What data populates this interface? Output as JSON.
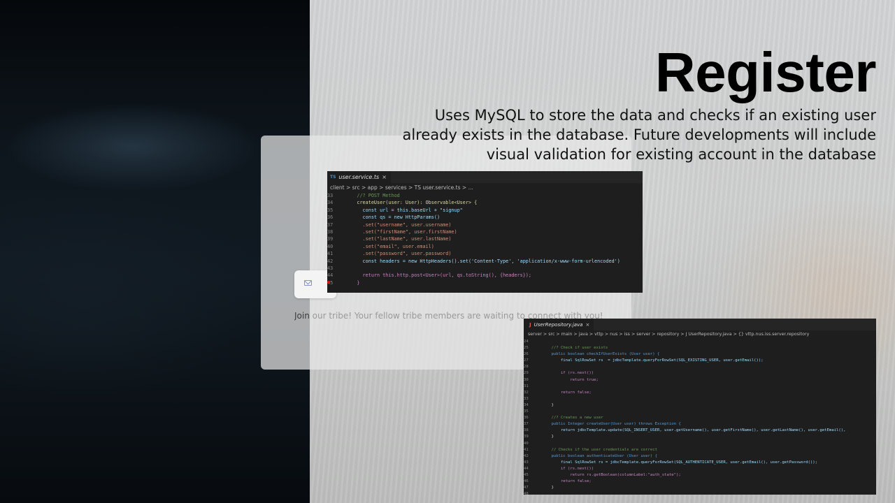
{
  "title": "Register",
  "description": "Uses MySQL to store the data and checks if an existing user already exists in the database. Future developments will include visual validation for existing account in the database",
  "login": {
    "tagline_visible": "Join",
    "tagline_faded": " our tribe! Your fellow tribe members are waiting to connect with you!"
  },
  "editor_ts": {
    "tab_badge": "TS",
    "tab_label": "user.service.ts",
    "close": "×",
    "breadcrumb": "client > src > app > services > TS user.service.ts > ...",
    "lines": [
      {
        "n": "33",
        "code": "    //? POST Method"
      },
      {
        "n": "34",
        "code": "    createUser(user: User): Observable<User> {"
      },
      {
        "n": "35",
        "code": "      const url = this.baseUrl + \"signup\""
      },
      {
        "n": "36",
        "code": "      const qs = new HttpParams()"
      },
      {
        "n": "37",
        "code": "      .set(\"username\", user.username)"
      },
      {
        "n": "38",
        "code": "      .set(\"firstName\", user.firstName)"
      },
      {
        "n": "39",
        "code": "      .set(\"lastName\", user.lastName)"
      },
      {
        "n": "40",
        "code": "      .set(\"email\", user.email)"
      },
      {
        "n": "41",
        "code": "      .set(\"password\", user.password)"
      },
      {
        "n": "42",
        "code": "      const headers = new HttpHeaders().set('Content-Type', 'application/x-www-form-urlencoded')"
      },
      {
        "n": "43",
        "code": ""
      },
      {
        "n": "44",
        "code": "      return this.http.post<User>(url, qs.toString(), {headers});"
      },
      {
        "n": "45",
        "code": "    }"
      }
    ]
  },
  "editor_java": {
    "tab_badge": "J",
    "tab_label": "UserRepository.java",
    "close": "×",
    "breadcrumb": "server > src > main > java > vttp > nus > iss > server > repository > J UserRepository.java > {} vttp.nus.iss.server.repository",
    "lines": [
      {
        "n": "24",
        "code": ""
      },
      {
        "n": "25",
        "code": "    //? Check if user exists"
      },
      {
        "n": "26",
        "code": "    public boolean checkIfUserExists (User user) {"
      },
      {
        "n": "27",
        "code": "        final SqlRowSet rs  = jdbcTemplate.queryForRowSet(SQL_EXISTING_USER, user.getEmail());"
      },
      {
        "n": "28",
        "code": ""
      },
      {
        "n": "29",
        "code": "        if (rs.next())"
      },
      {
        "n": "30",
        "code": "            return true;"
      },
      {
        "n": "31",
        "code": ""
      },
      {
        "n": "32",
        "code": "        return false;"
      },
      {
        "n": "33",
        "code": ""
      },
      {
        "n": "34",
        "code": "    }"
      },
      {
        "n": "35",
        "code": ""
      },
      {
        "n": "36",
        "code": "    //? Creates a new user"
      },
      {
        "n": "37",
        "code": "    public Integer createUser(User user) throws Exception {"
      },
      {
        "n": "38",
        "code": "        return jdbcTemplate.update(SQL_INSERT_USER, user.getUsername(), user.getFirstName(), user.getLastName(), user.getEmail(),"
      },
      {
        "n": "39",
        "code": "    }"
      },
      {
        "n": "40",
        "code": ""
      },
      {
        "n": "41",
        "code": "    // Checks if the user credentials are correct"
      },
      {
        "n": "42",
        "code": "    public boolean authenticateUser (User user) {"
      },
      {
        "n": "43",
        "code": "        final SqlRowSet rs = jdbcTemplate.queryForRowSet(SQL_AUTHENTICATE_USER, user.getEmail(), user.getPassword());"
      },
      {
        "n": "44",
        "code": "        if (rs.next())"
      },
      {
        "n": "45",
        "code": "            return rs.getBoolean(columnLabel:\"auth_state\");"
      },
      {
        "n": "46",
        "code": "        return false;"
      },
      {
        "n": "47",
        "code": "    }"
      },
      {
        "n": "48",
        "code": ""
      }
    ]
  },
  "colors": {
    "title": "#000000",
    "editor_bg": "#1e1e1e",
    "tab_bar_bg": "#252526",
    "ts_badge": "#4b8ec9",
    "java_badge": "#e25c4a",
    "breakpoint": "#e51400"
  }
}
